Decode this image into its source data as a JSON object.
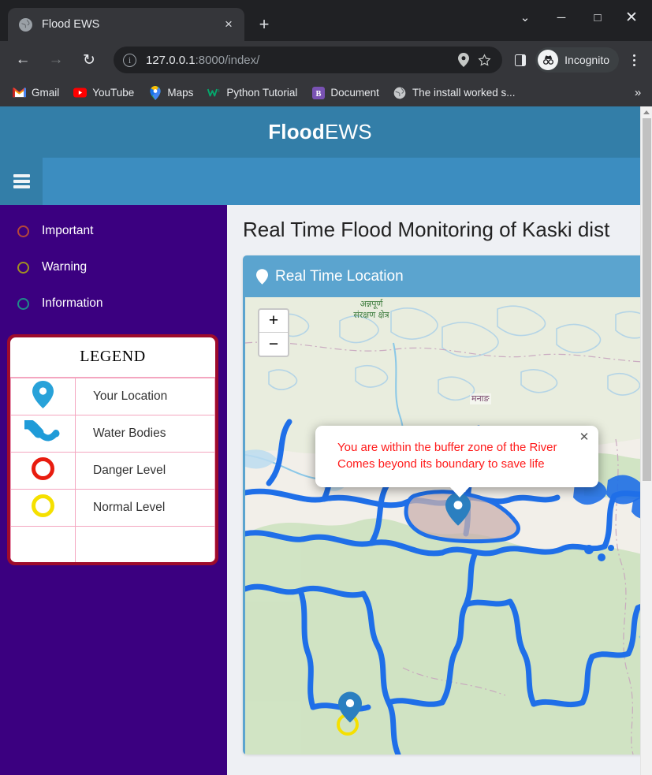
{
  "browser": {
    "tab": {
      "title": "Flood EWS",
      "favicon": "globe-icon",
      "close": "×"
    },
    "new_tab": "+",
    "window_controls": {
      "expand": "⌄",
      "minimize": "─",
      "maximize": "□",
      "close": "✕"
    },
    "nav": {
      "back": "←",
      "forward": "→",
      "reload": "↻"
    },
    "omnibox": {
      "info_icon": "ⓘ",
      "url_host": "127.0.0.1",
      "url_rest": ":8000/index/",
      "location_icon": "location-pin-icon",
      "bookmark_icon": "star-icon"
    },
    "side_panel_icon": "side-panel-icon",
    "incognito": {
      "label": "Incognito",
      "icon": "incognito-spy-icon"
    },
    "menu_icon": "kebab-menu-icon",
    "bookmarks": [
      {
        "label": "Gmail",
        "icon": "gmail-icon"
      },
      {
        "label": "YouTube",
        "icon": "youtube-icon"
      },
      {
        "label": "Maps",
        "icon": "google-maps-icon"
      },
      {
        "label": "Python Tutorial",
        "icon": "w3schools-icon"
      },
      {
        "label": "Document",
        "icon": "bootstrap-icon"
      },
      {
        "label": "The install worked s...",
        "icon": "globe-icon"
      }
    ],
    "bookmarks_overflow": "»"
  },
  "page": {
    "brand": {
      "bold": "Flood",
      "rest": "EWS"
    },
    "menu_toggle": "hamburger-icon",
    "sidebar": {
      "items": [
        {
          "label": "Important",
          "color": "#b5463a"
        },
        {
          "label": "Warning",
          "color": "#a08e22"
        },
        {
          "label": "Information",
          "color": "#1f8a8a"
        }
      ],
      "legend": {
        "title": "LEGEND",
        "rows": [
          {
            "icon": "map-pin-icon",
            "label": "Your Location",
            "color": "#28a2d9"
          },
          {
            "icon": "river-icon",
            "label": "Water Bodies",
            "color": "#1f9bd8"
          },
          {
            "icon": "ring-icon",
            "label": "Danger Level",
            "color": "#e81c0f"
          },
          {
            "icon": "ring-icon",
            "label": "Normal Level",
            "color": "#f5e000"
          }
        ]
      }
    },
    "main": {
      "title": "Real Time Flood Monitoring of Kaski dist",
      "card": {
        "header_icon": "map-pin-icon",
        "header": "Real Time Location"
      },
      "map": {
        "zoom_in": "+",
        "zoom_out": "−",
        "labels": [
          {
            "text": "अन्नपूर्ण",
            "text2": "संरक्षण क्षेत्र",
            "style": "green"
          },
          {
            "text": "मनाङ",
            "style": "plum"
          }
        ],
        "popup": {
          "line1": "You are within the buffer zone of the River",
          "line2": "Comes beyond its boundary to save life",
          "close": "✕"
        }
      }
    }
  },
  "scrollbar": {
    "up": "▲",
    "down": "▼"
  }
}
